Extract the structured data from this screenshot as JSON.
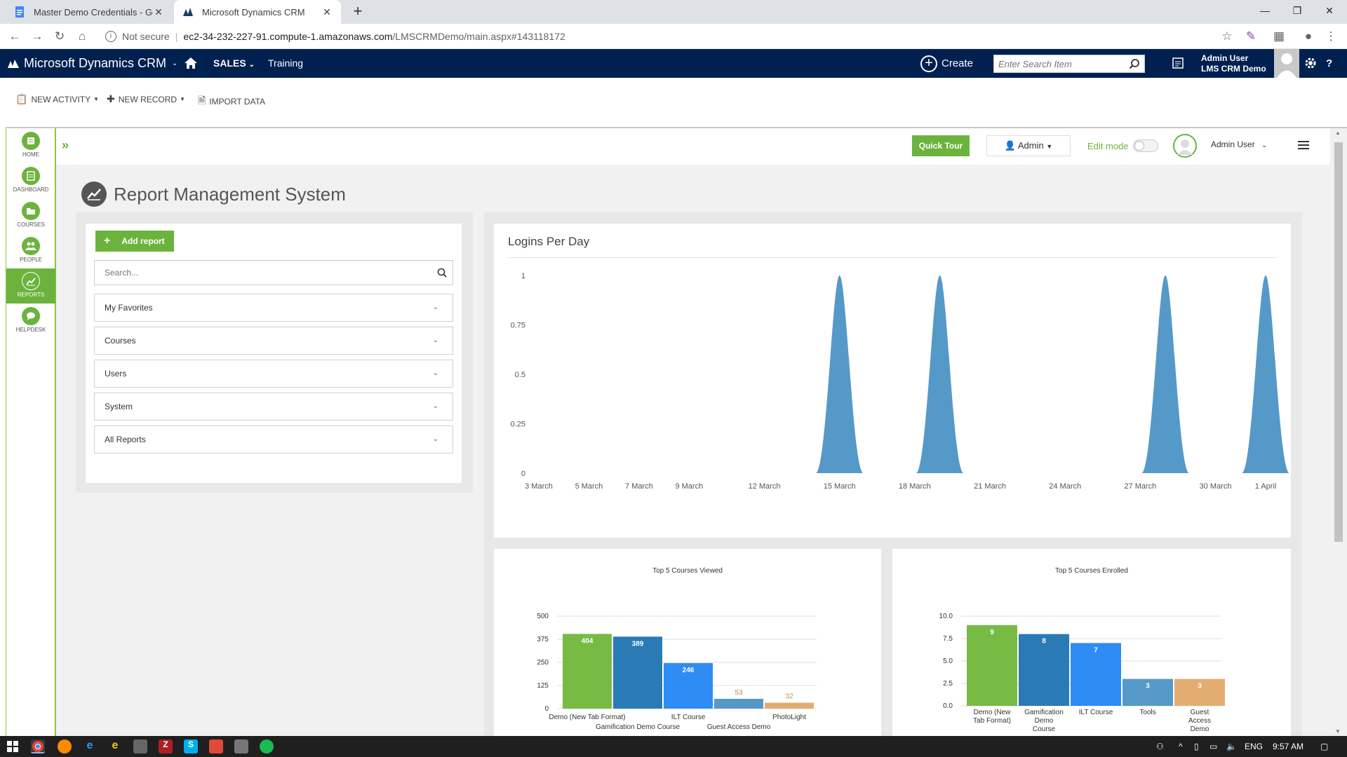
{
  "browser": {
    "tabs": [
      {
        "title": "Master Demo Credentials - Goog",
        "active": false
      },
      {
        "title": "Microsoft Dynamics CRM",
        "active": true
      }
    ],
    "address": {
      "security": "Not secure",
      "host": "ec2-34-232-227-91.compute-1.amazonaws.com",
      "path": "/LMSCRMDemo/main.aspx#143118172"
    }
  },
  "crm_nav": {
    "brand": "Microsoft Dynamics CRM",
    "area": "SALES",
    "sub": "Training",
    "create_label": "Create",
    "search_placeholder": "Enter Search Item",
    "user_name": "Admin User",
    "org_name": "LMS CRM Demo",
    "help": "?"
  },
  "command_bar": {
    "new_activity": "NEW ACTIVITY",
    "new_record": "NEW RECORD",
    "import_data": "IMPORT DATA"
  },
  "sidebar": {
    "items": [
      {
        "label": "HOME",
        "icon": "home-icon"
      },
      {
        "label": "DASHBOARD",
        "icon": "dashboard-icon"
      },
      {
        "label": "COURSES",
        "icon": "courses-icon"
      },
      {
        "label": "PEOPLE",
        "icon": "people-icon"
      },
      {
        "label": "REPORTS",
        "icon": "reports-icon",
        "active": true
      },
      {
        "label": "HELPDESK",
        "icon": "helpdesk-icon"
      }
    ]
  },
  "lms_top": {
    "quick_tour": "Quick Tour",
    "role": "Admin",
    "edit_mode": "Edit mode",
    "user": "Admin User"
  },
  "page": {
    "title": "Report Management System",
    "add_report": "Add report",
    "search_placeholder": "Search...",
    "accordion": [
      "My Favorites",
      "Courses",
      "Users",
      "System",
      "All Reports"
    ]
  },
  "charts": {
    "accent": "#5599c8",
    "green": "#77bb44"
  },
  "chart_data": [
    {
      "type": "area",
      "title": "Logins Per Day",
      "x_ticks": [
        "3 March",
        "5 March",
        "7 March",
        "9 March",
        "12 March",
        "15 March",
        "18 March",
        "21 March",
        "24 March",
        "27 March",
        "30 March",
        "1 April"
      ],
      "y_ticks": [
        "0",
        "0.25",
        "0.5",
        "0.75",
        "1"
      ],
      "ylim": [
        0,
        1
      ],
      "peaks": [
        {
          "date": "15 March",
          "value": 1
        },
        {
          "date": "19 March",
          "value": 1
        },
        {
          "date": "28 March",
          "value": 1
        },
        {
          "date": "1 April",
          "value": 1
        }
      ]
    },
    {
      "type": "bar",
      "title": "Top 5 Courses Viewed",
      "categories": [
        "Demo (New Tab Format)",
        "Gamification Demo Course",
        "ILT Course",
        "Guest Access Demo",
        "PhotoLight"
      ],
      "values": [
        404,
        389,
        246,
        53,
        32
      ],
      "colors": [
        "#77bb44",
        "#2a7ab6",
        "#2e8cf5",
        "#5599c8",
        "#e3ad72"
      ],
      "y_ticks": [
        "0",
        "125",
        "250",
        "375",
        "500"
      ],
      "ylim": [
        0,
        500
      ]
    },
    {
      "type": "bar",
      "title": "Top 5 Courses Enrolled",
      "categories": [
        "Demo (New Tab Format)",
        "Gamification Demo Course",
        "ILT Course",
        "Tools",
        "Guest Access Demo"
      ],
      "category_lines": [
        [
          "Demo (New",
          "Tab Format)"
        ],
        [
          "Gamification",
          "Demo",
          "Course"
        ],
        [
          "ILT Course"
        ],
        [
          "Tools"
        ],
        [
          "Guest",
          "Access",
          "Demo"
        ]
      ],
      "values": [
        9,
        8,
        7,
        3,
        3
      ],
      "colors": [
        "#77bb44",
        "#2a7ab6",
        "#2e8cf5",
        "#5599c8",
        "#e3ad72"
      ],
      "y_ticks": [
        "0.0",
        "2.5",
        "5.0",
        "7.5",
        "10.0"
      ],
      "ylim": [
        0,
        10
      ]
    }
  ],
  "taskbar": {
    "lang": "ENG",
    "time": "9:57 AM"
  }
}
